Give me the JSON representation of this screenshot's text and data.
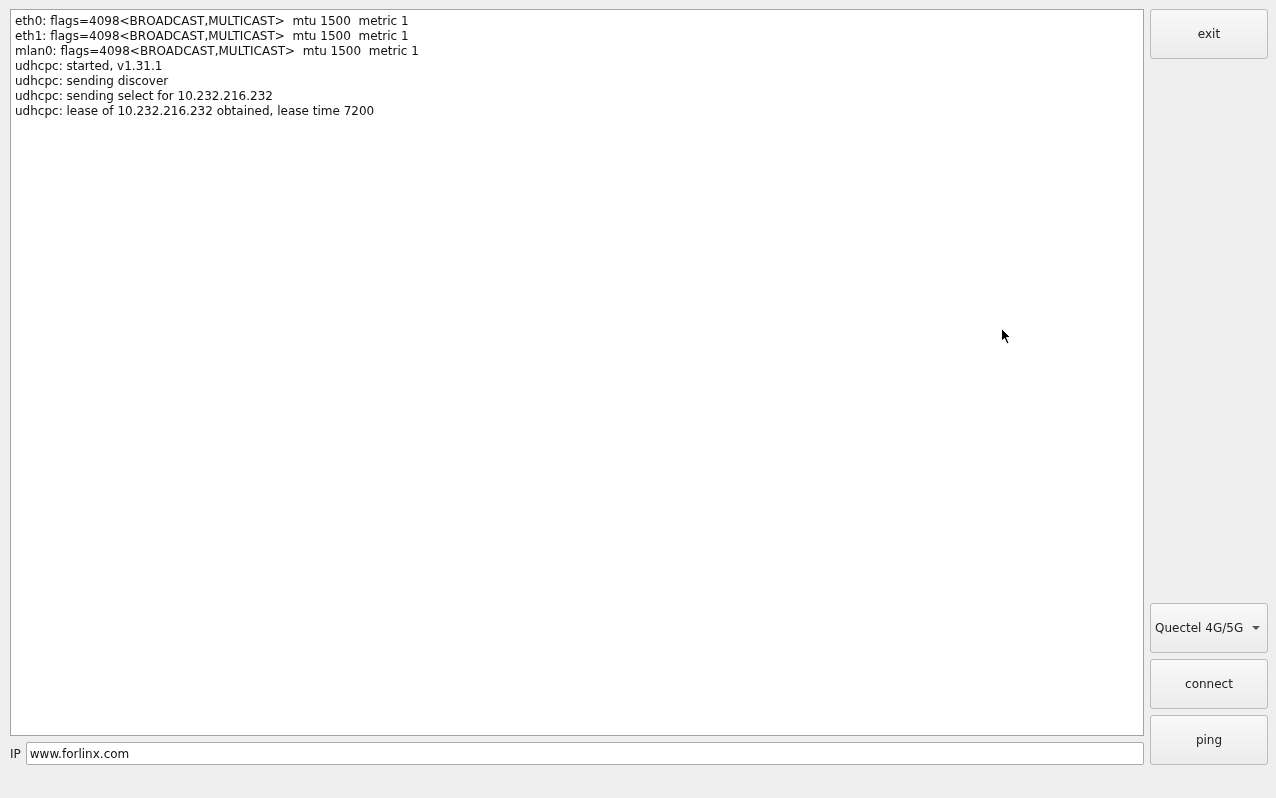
{
  "log": {
    "lines": [
      "eth0: flags=4098<BROADCAST,MULTICAST>  mtu 1500  metric 1",
      "eth1: flags=4098<BROADCAST,MULTICAST>  mtu 1500  metric 1",
      "mlan0: flags=4098<BROADCAST,MULTICAST>  mtu 1500  metric 1",
      "udhcpc: started, v1.31.1",
      "udhcpc: sending discover",
      "udhcpc: sending select for 10.232.216.232",
      "udhcpc: lease of 10.232.216.232 obtained, lease time 7200"
    ]
  },
  "exit_button": {
    "label": "exit"
  },
  "modem_select": {
    "value": "Quectel 4G/5G"
  },
  "connect_button": {
    "label": "connect"
  },
  "ping_button": {
    "label": "ping"
  },
  "ip_field": {
    "label": "IP",
    "value": "www.forlinx.com"
  }
}
